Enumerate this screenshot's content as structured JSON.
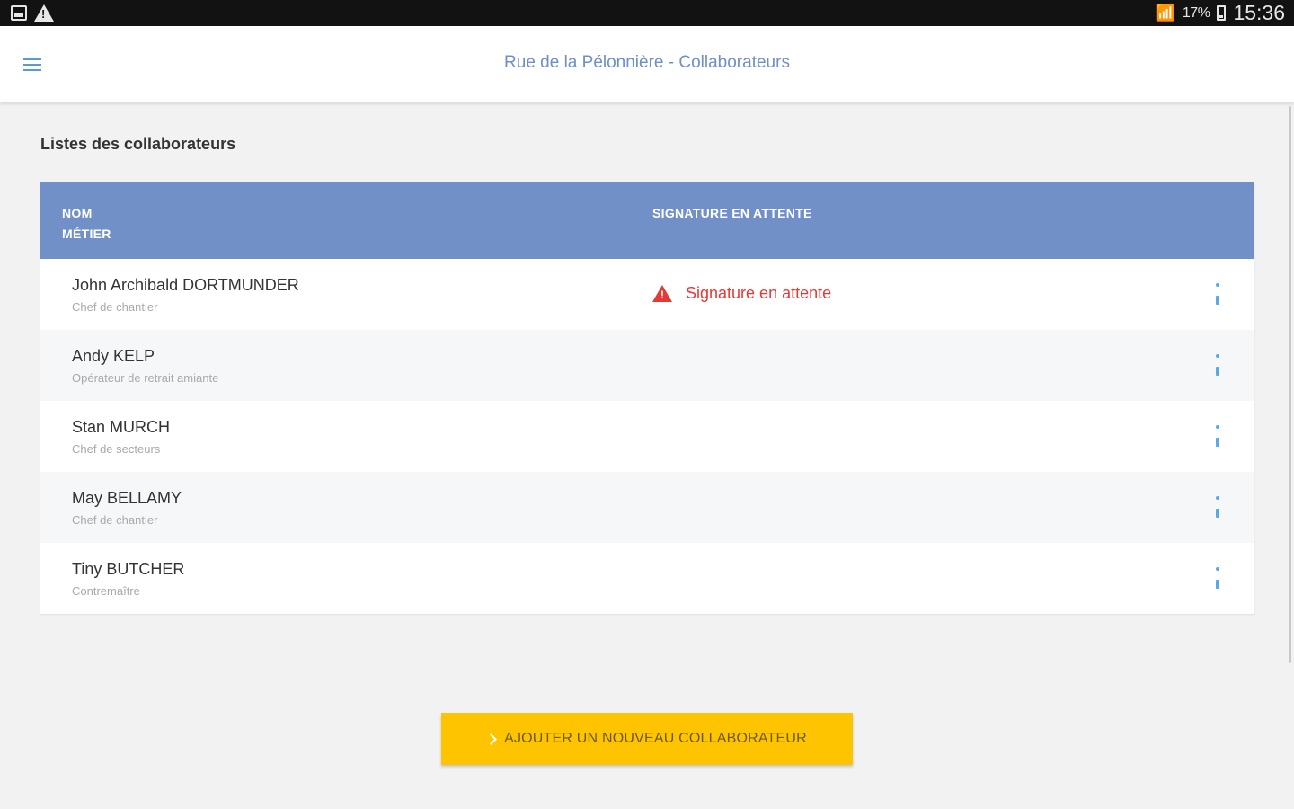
{
  "status_bar": {
    "battery_text": "17%",
    "time": "15:36",
    "icons": [
      "gallery-icon",
      "warning-icon",
      "signal-icon",
      "battery-icon"
    ]
  },
  "header": {
    "title": "Rue de la Pélonnière - Collaborateurs",
    "menu_icon": "hamburger-menu-icon"
  },
  "section": {
    "title": "Listes des collaborateurs"
  },
  "table": {
    "columns": {
      "name": "NOM",
      "job": "MÉTIER",
      "signature": "SIGNATURE EN ATTENTE"
    },
    "rows": [
      {
        "name": "John Archibald DORTMUNDER",
        "job": "Chef de chantier",
        "signature": "Signature en attente"
      },
      {
        "name": "Andy KELP",
        "job": "Opérateur de retrait amiante",
        "signature": ""
      },
      {
        "name": "Stan MURCH",
        "job": "Chef de secteurs",
        "signature": ""
      },
      {
        "name": "May BELLAMY",
        "job": "Chef de chantier",
        "signature": ""
      },
      {
        "name": "Tiny BUTCHER",
        "job": "Contremaître",
        "signature": ""
      }
    ]
  },
  "actions": {
    "add_button": "AJOUTER UN NOUVEAU COLLABORATEUR"
  },
  "colors": {
    "accent": "#7190c8",
    "warning": "#e53935",
    "button": "#ffc400"
  }
}
